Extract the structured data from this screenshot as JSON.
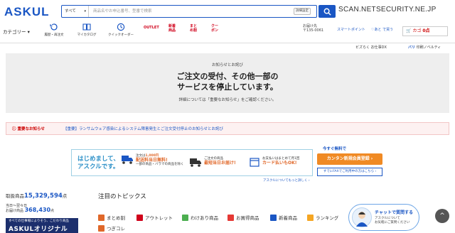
{
  "header": {
    "logo": "ASKUL",
    "category_select": "すべて",
    "search_placeholder": "商品名やお申込番号、型番で検索",
    "advanced_search": "詳細設定",
    "watermark": "SCAN.NETSECURITY.NE.JP"
  },
  "nav": {
    "category_menu": "カテゴリー",
    "items": [
      {
        "label": "履歴・再注文",
        "icon": "history-icon"
      },
      {
        "label": "マイカタログ",
        "icon": "catalog-icon"
      },
      {
        "label": "クイックオーダー",
        "icon": "quick-order-icon"
      }
    ],
    "pills": [
      {
        "label": "OUTLET",
        "color": "#d0021b"
      },
      {
        "label": "新着\n商品",
        "color": "#d0021b"
      },
      {
        "label": "まと\nめ割",
        "color": "#d0021b"
      },
      {
        "label": "クー\nポン",
        "color": "#d0021b"
      }
    ],
    "delivery_label": "お届け先",
    "delivery_zip": "〒135-0061",
    "smart_point": "スマートポイント",
    "favorites": "あと で買う",
    "cart_label": "カゴ",
    "cart_count": "0点"
  },
  "biz": {
    "bizraku": "ビズらく",
    "office_dx": "お仕事DX",
    "print": "バリ",
    "print_label": "印刷ノベルティ"
  },
  "notice": {
    "small": "お知らせとお詫び",
    "title_line1": "ご注文の受付、その他一部の",
    "title_line2": "サービスを停止しています。",
    "desc": "詳細については「重要なお知らせ」をご確認ください。"
  },
  "alert": {
    "label": "重要なお知らせ",
    "text": "【重要】ランサムウェア感染によるシステム障害発生とご注文受付停止のお知らせとお詫び"
  },
  "banner": {
    "hello_line1": "はじめまして、",
    "hello_line2": "アスクルです。",
    "cell1_line1": "注文は",
    "cell1_em": "1,000円",
    "cell1_line2": "配送料当日無料!",
    "cell1_line3": "一部の商品・バラマの商品を除く",
    "cell2_line1": "ご注文の商品",
    "cell2_em": "最短当日お届け!",
    "cell3_line1": "お支払いはまとめて月1回",
    "cell3_em": "カード払いもOK!",
    "free_label": "今すぐ無料で",
    "register_button": "カンタン新規会員登録 ›",
    "fax_button": "すでにFAXでご利用中の方はこちら ›",
    "more_link": "アスクルについてもっと詳しく ›"
  },
  "stats": {
    "items_label": "取扱商品",
    "items_value": "15,329,594",
    "items_unit": "点",
    "same_day_label1": "当日〜翌々日",
    "same_day_label2": "お届け商品",
    "same_day_value": "368,430",
    "same_day_unit": "点"
  },
  "original_banner": {
    "small": "すべての仕事場によりそう、こだわり商品",
    "big": "ASKULオリジナル"
  },
  "topics": {
    "title": "注目のトピックス",
    "items": [
      {
        "label": "まとめ割",
        "color": "#e0682a"
      },
      {
        "label": "アウトレット",
        "color": "#d0021b"
      },
      {
        "label": "わけあり商品",
        "color": "#4caf50"
      },
      {
        "label": "お買得商品",
        "color": "#e53935"
      },
      {
        "label": "新着商品",
        "color": "#1a56c4"
      },
      {
        "label": "ランキング",
        "color": "#f5a623"
      },
      {
        "label": "つぎコレ",
        "color": "#e0682a"
      }
    ]
  },
  "chat": {
    "title": "チャットで質問する",
    "line1": "アスクルについて",
    "line2": "お気軽にご質問ください"
  },
  "scrolltop": "^"
}
